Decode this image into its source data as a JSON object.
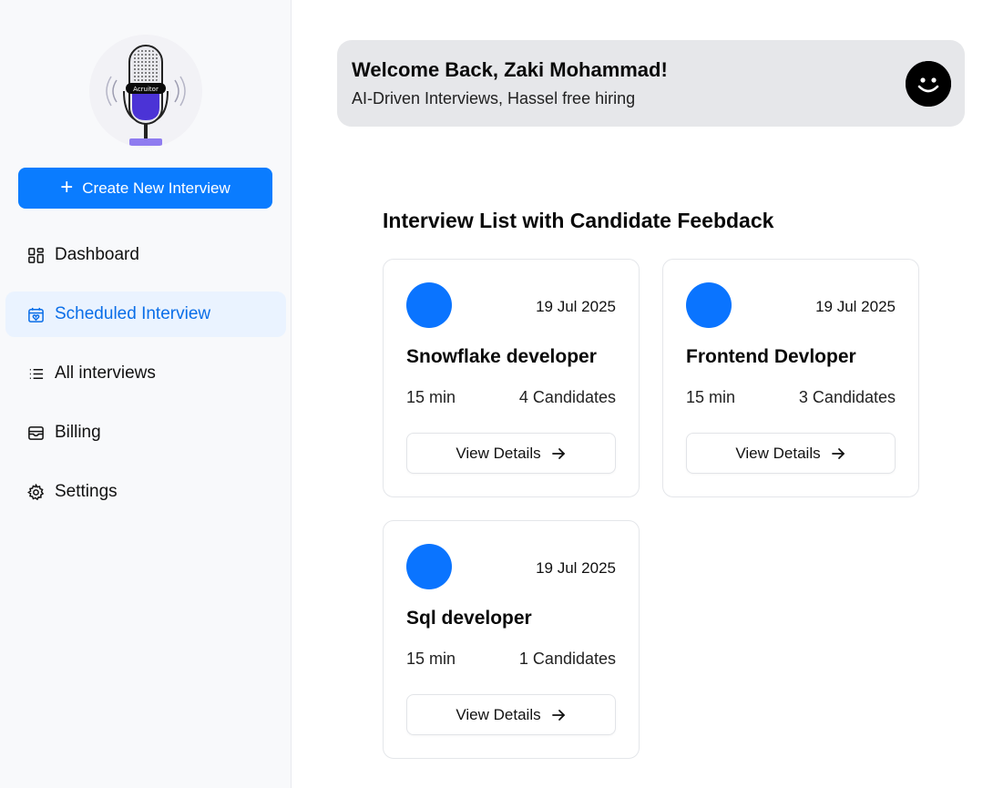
{
  "sidebar": {
    "logo_text": "Acruitor",
    "create_button": "Create New Interview",
    "items": [
      {
        "label": "Dashboard",
        "icon": "dashboard-icon",
        "active": false
      },
      {
        "label": "Scheduled Interview",
        "icon": "calendar-heart-icon",
        "active": true
      },
      {
        "label": "All interviews",
        "icon": "list-icon",
        "active": false
      },
      {
        "label": "Billing",
        "icon": "wallet-icon",
        "active": false
      },
      {
        "label": "Settings",
        "icon": "gear-icon",
        "active": false
      }
    ]
  },
  "header": {
    "title": "Welcome Back, Zaki Mohammad!",
    "subtitle": "AI-Driven Interviews, Hassel free hiring",
    "avatar_icon": "smiley-avatar-icon"
  },
  "main": {
    "section_title": "Interview List with Candidate Feebdack",
    "cards": [
      {
        "date": "19 Jul 2025",
        "title": "Snowflake developer",
        "duration": "15 min",
        "candidates": "4 Candidates",
        "button": "View Details"
      },
      {
        "date": "19 Jul 2025",
        "title": "Frontend Devloper",
        "duration": "15 min",
        "candidates": "3 Candidates",
        "button": "View Details"
      },
      {
        "date": "19 Jul 2025",
        "title": "Sql developer",
        "duration": "15 min",
        "candidates": "1 Candidates",
        "button": "View Details"
      }
    ]
  },
  "colors": {
    "accent": "#0a7cff",
    "active_bg": "#eaf3ff",
    "active_text": "#0a6ee8",
    "banner_bg": "#e6e7ea"
  }
}
